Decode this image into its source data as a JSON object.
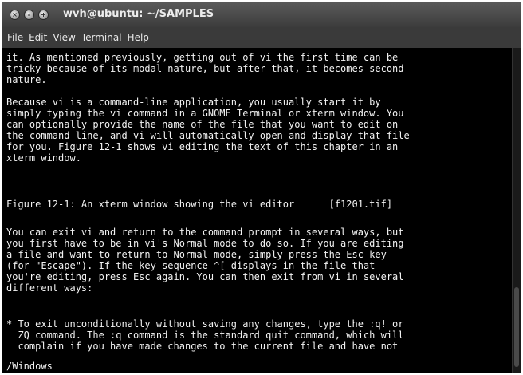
{
  "window": {
    "title": "wvh@ubuntu: ~/SAMPLES",
    "buttons": [
      "close",
      "minimize",
      "maximize"
    ]
  },
  "menubar": {
    "items": [
      "File",
      "Edit",
      "View",
      "Terminal",
      "Help"
    ]
  },
  "terminal": {
    "lines": [
      "it. As mentioned previously, getting out of vi the first time can be",
      "tricky because of its modal nature, but after that, it becomes second",
      "nature.",
      "",
      "Because vi is a command-line application, you usually start it by",
      "simply typing the vi command in a GNOME Terminal or xterm window. You",
      "can optionally provide the name of the file that you want to edit on",
      "the command line, and vi will automatically open and display that file",
      "for you. Figure 12-1 shows vi editing the text of this chapter in an",
      "xterm window.",
      "",
      "Figure 12-1: An xterm window showing the vi editor      [f1201.tif]",
      "",
      "You can exit vi and return to the command prompt in several ways, but",
      "you first have to be in vi's Normal mode to do so. If you are editing",
      "a file and want to return to Normal mode, simply press the Esc key",
      "(for \"Escape\"). If the key sequence ^[ displays in the file that",
      "you're editing, press Esc again. You can then exit from vi in several",
      "different ways:",
      "",
      "* To exit unconditionally without saving any changes, type the :q! or",
      "  ZQ command. The :q command is the standard quit command, which will",
      "  complain if you have made changes to the current file and have not",
      "/Windows"
    ]
  }
}
